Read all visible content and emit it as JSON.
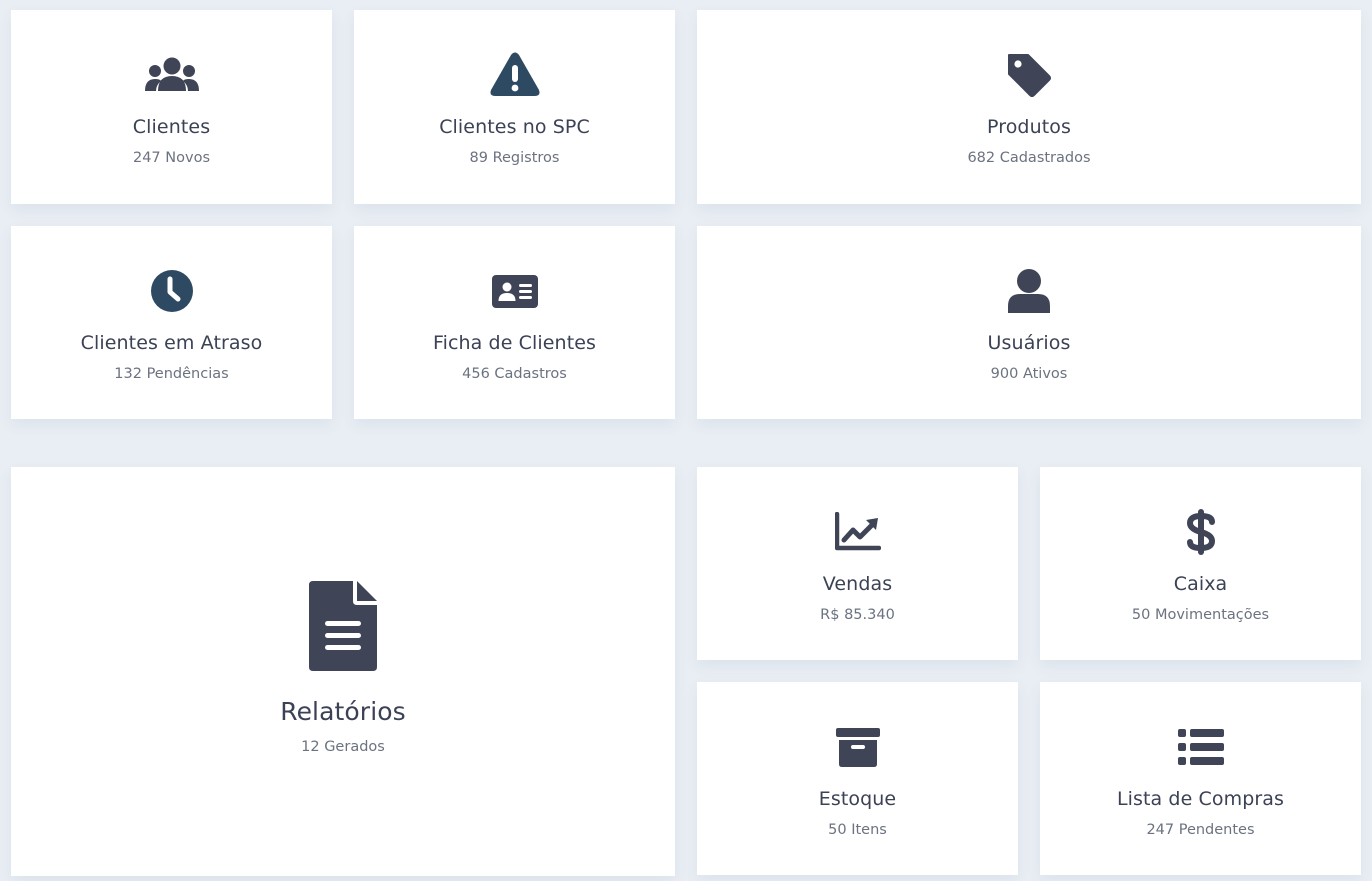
{
  "colors": {
    "background": "#e9eef4",
    "card": "#ffffff",
    "icon_dark": "#3f4456",
    "icon_navy": "#2e4a62",
    "title_text": "#3b4255",
    "subtitle_text": "#6b7280"
  },
  "cards": [
    {
      "id": "clientes",
      "icon": "users-icon",
      "title": "Clientes",
      "subtitle": "247 Novos"
    },
    {
      "id": "clientes-spc",
      "icon": "warning-icon",
      "title": "Clientes no SPC",
      "subtitle": "89 Registros"
    },
    {
      "id": "produtos",
      "icon": "tag-icon",
      "title": "Produtos",
      "subtitle": "682 Cadastrados"
    },
    {
      "id": "clientes-atraso",
      "icon": "clock-icon",
      "title": "Clientes em Atraso",
      "subtitle": "132 Pendências"
    },
    {
      "id": "ficha-clientes",
      "icon": "id-card-icon",
      "title": "Ficha de Clientes",
      "subtitle": "456 Cadastros"
    },
    {
      "id": "usuarios",
      "icon": "user-icon",
      "title": "Usuários",
      "subtitle": "900 Ativos"
    },
    {
      "id": "relatorios",
      "icon": "file-icon",
      "title": "Relatórios",
      "subtitle": "12 Gerados"
    },
    {
      "id": "vendas",
      "icon": "chart-line-icon",
      "title": "Vendas",
      "subtitle": "R$ 85.340"
    },
    {
      "id": "caixa",
      "icon": "dollar-icon",
      "title": "Caixa",
      "subtitle": "50 Movimentações"
    },
    {
      "id": "estoque",
      "icon": "archive-box-icon",
      "title": "Estoque",
      "subtitle": "50 Itens"
    },
    {
      "id": "lista-compras",
      "icon": "list-icon",
      "title": "Lista de Compras",
      "subtitle": "247 Pendentes"
    }
  ]
}
